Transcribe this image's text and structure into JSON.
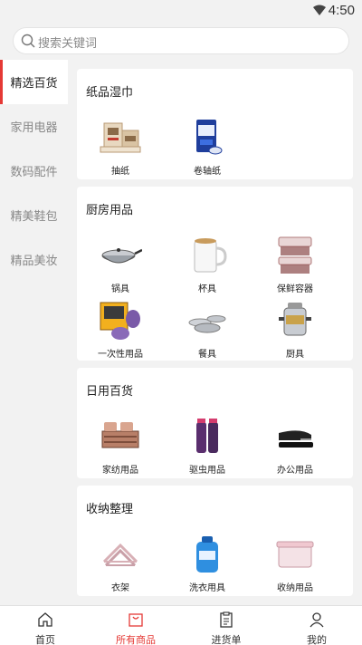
{
  "status_bar": {
    "time": "4:50"
  },
  "search": {
    "placeholder": "搜索关键词"
  },
  "sidebar": {
    "items": [
      {
        "label": "精选百货",
        "active": true
      },
      {
        "label": "家用电器",
        "active": false
      },
      {
        "label": "数码配件",
        "active": false
      },
      {
        "label": "精美鞋包",
        "active": false
      },
      {
        "label": "精品美妆",
        "active": false
      }
    ]
  },
  "sections": [
    {
      "title": "纸品湿巾",
      "products": [
        {
          "label": "抽纸",
          "icon": "tissue-box-icon"
        },
        {
          "label": "卷轴纸",
          "icon": "roll-paper-icon"
        }
      ]
    },
    {
      "title": "厨房用品",
      "products": [
        {
          "label": "锅具",
          "icon": "wok-icon"
        },
        {
          "label": "杯具",
          "icon": "mug-icon"
        },
        {
          "label": "保鲜容器",
          "icon": "food-container-icon"
        },
        {
          "label": "一次性用品",
          "icon": "disposable-items-icon"
        },
        {
          "label": "餐具",
          "icon": "tableware-icon"
        },
        {
          "label": "厨具",
          "icon": "cookware-icon"
        }
      ]
    },
    {
      "title": "日用百货",
      "products": [
        {
          "label": "家纺用品",
          "icon": "bedding-icon"
        },
        {
          "label": "驱虫用品",
          "icon": "insect-spray-icon"
        },
        {
          "label": "办公用品",
          "icon": "stapler-icon"
        }
      ]
    },
    {
      "title": "收纳整理",
      "products": [
        {
          "label": "衣架",
          "icon": "hanger-icon"
        },
        {
          "label": "洗衣用具",
          "icon": "detergent-icon"
        },
        {
          "label": "收纳用品",
          "icon": "storage-box-icon"
        }
      ]
    }
  ],
  "bottom_nav": {
    "tabs": [
      {
        "label": "首页",
        "icon": "home-icon",
        "active": false
      },
      {
        "label": "所有商品",
        "icon": "shopping-bag-icon",
        "active": true
      },
      {
        "label": "进货单",
        "icon": "clipboard-icon",
        "active": false
      },
      {
        "label": "我的",
        "icon": "user-icon",
        "active": false
      }
    ]
  },
  "colors": {
    "accent": "#e53935",
    "background": "#f2f2f2",
    "card": "#ffffff"
  }
}
